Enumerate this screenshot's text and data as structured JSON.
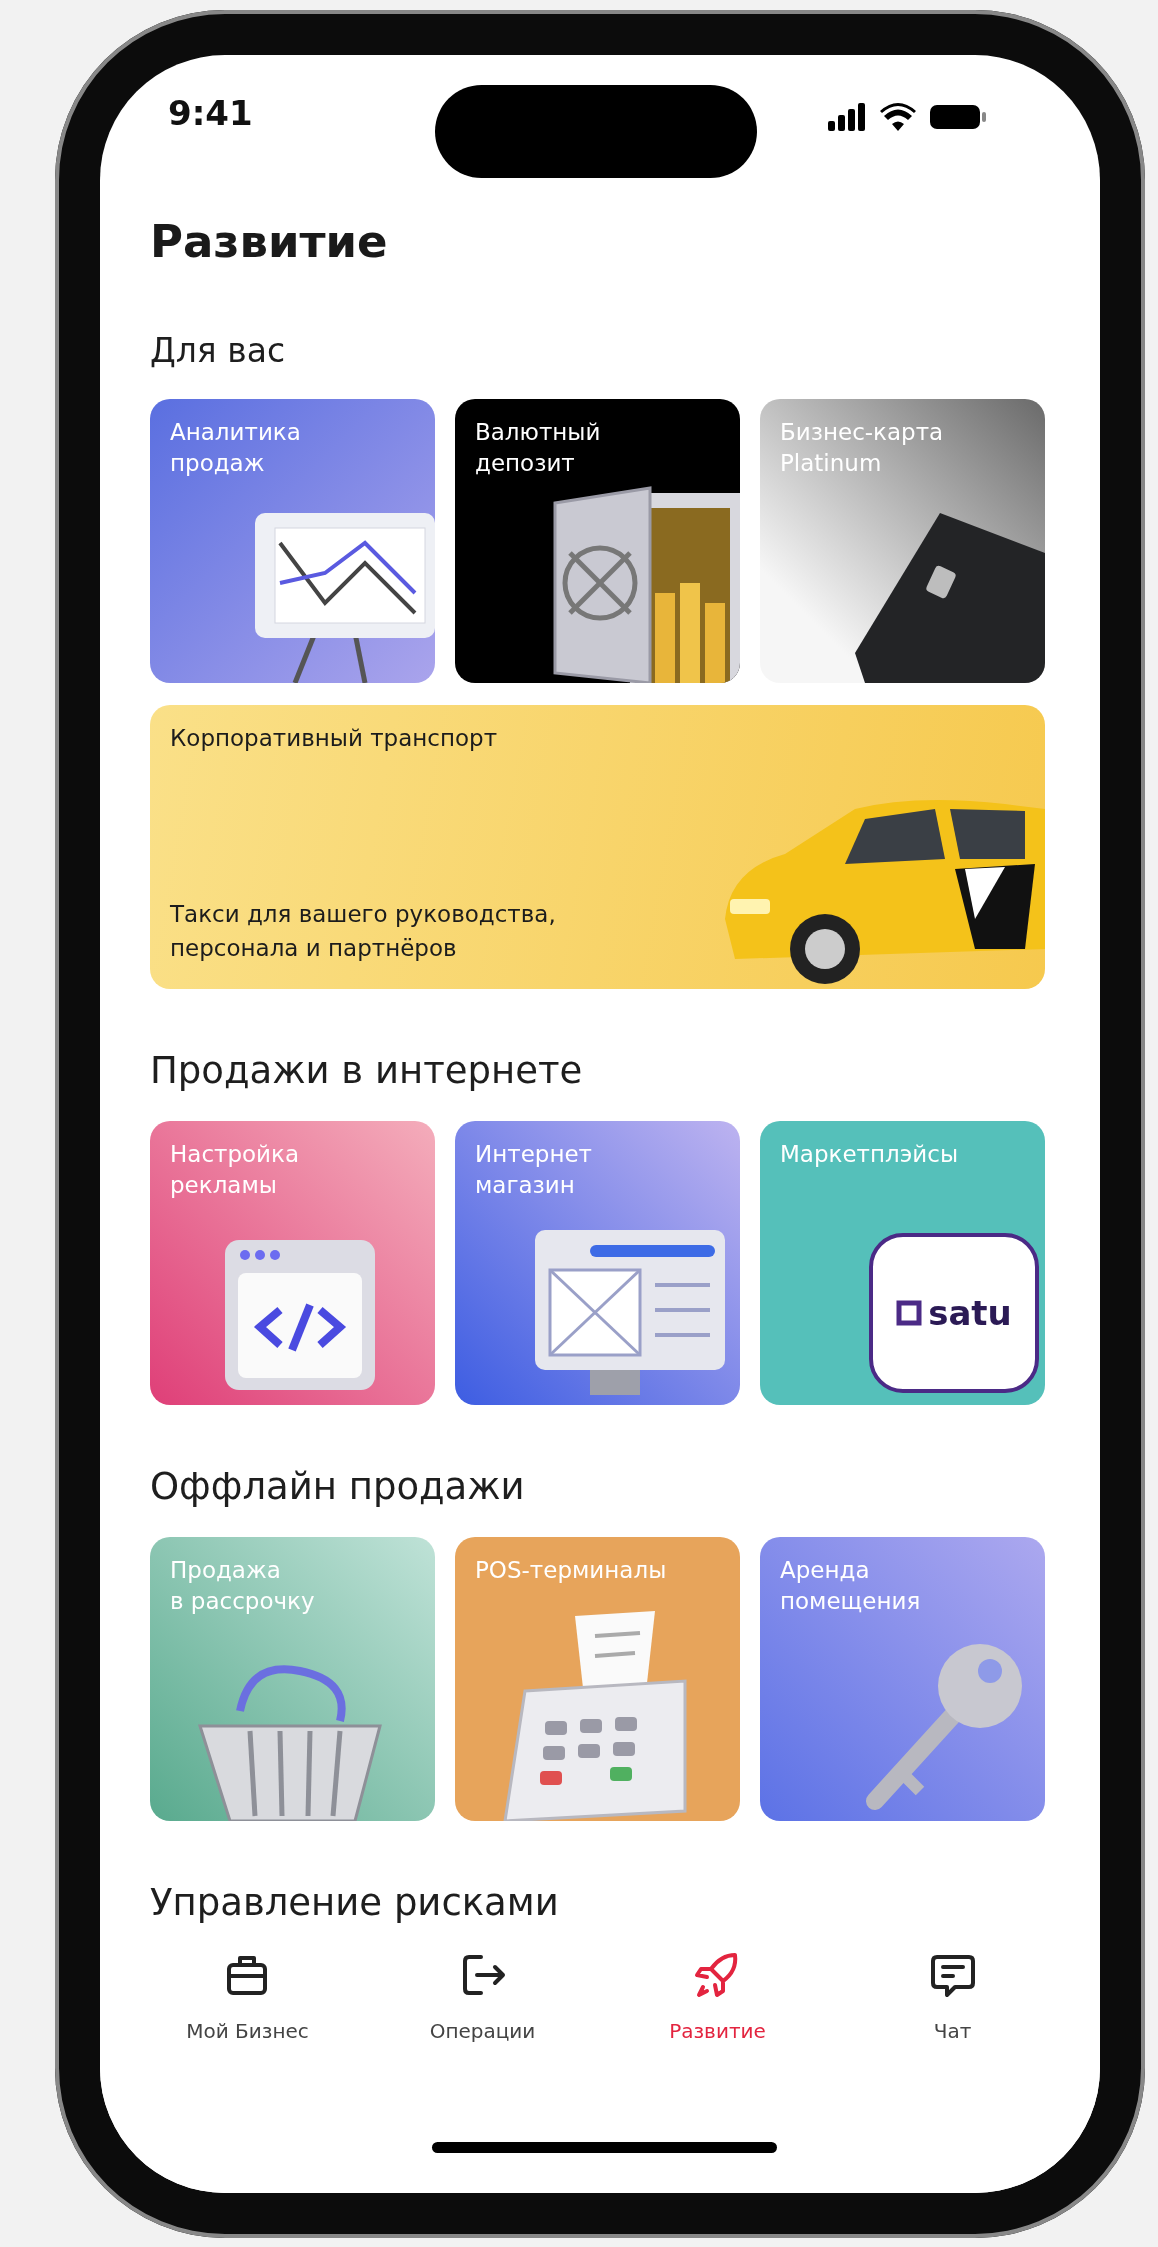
{
  "status_bar": {
    "time": "9:41"
  },
  "title": "Развитие",
  "sections": [
    {
      "heading": "Для вас",
      "tiles": [
        {
          "label": "Аналитика\nпродаж",
          "kind": "chart"
        },
        {
          "label": "Валютный\nдепозит",
          "kind": "safe"
        },
        {
          "label": "Бизнес-карта\nPlatinum",
          "kind": "card"
        },
        {
          "label": "Корпоративный транспорт",
          "subtitle": "Такси для вашего руководства,\nперсонала и партнёров",
          "kind": "taxi"
        }
      ]
    },
    {
      "heading": "Продажи в интернете",
      "tiles": [
        {
          "label": "Настройка\nрекламы",
          "kind": "code"
        },
        {
          "label": "Интернет\nмагазин",
          "kind": "webpage"
        },
        {
          "label": "Маркетплэйсы",
          "kind": "marketplace",
          "logo_text": "satu"
        }
      ]
    },
    {
      "heading": "Оффлайн продажи",
      "tiles": [
        {
          "label": "Продажа\nв рассрочку",
          "kind": "basket"
        },
        {
          "label": "POS-терминалы",
          "kind": "terminal"
        },
        {
          "label": "Аренда\nпомещения",
          "kind": "key"
        }
      ]
    },
    {
      "heading": "Управление рисками"
    }
  ],
  "nav": {
    "items": [
      {
        "label": "Мой Бизнес",
        "kind": "briefcase",
        "selected": false
      },
      {
        "label": "Операции",
        "kind": "exit",
        "selected": false
      },
      {
        "label": "Развитие",
        "kind": "rocket",
        "selected": true
      },
      {
        "label": "Чат",
        "kind": "chat",
        "selected": false
      }
    ]
  }
}
